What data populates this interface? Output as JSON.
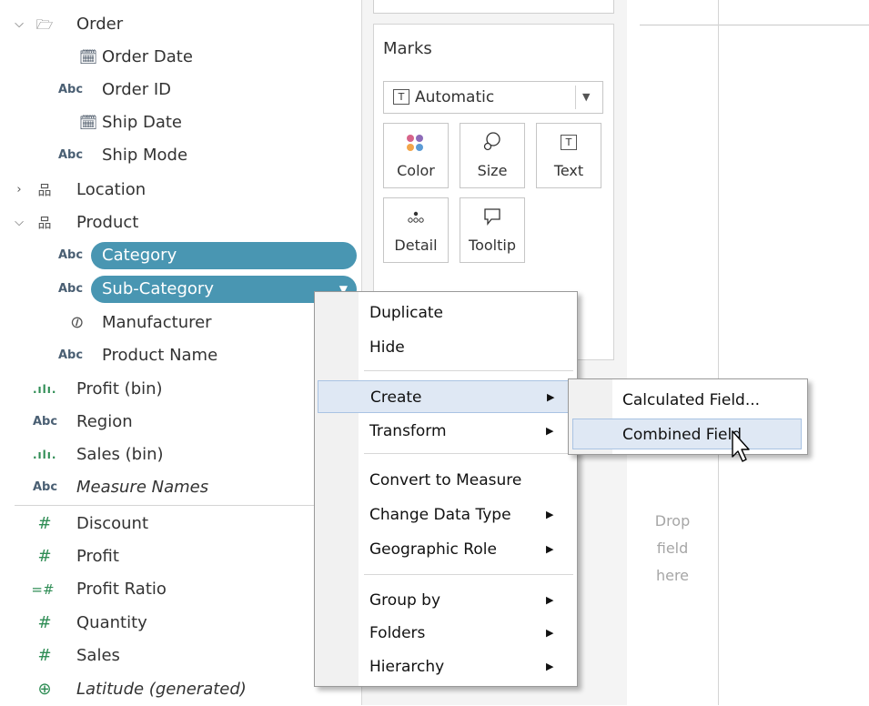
{
  "data_pane": {
    "folder_order": {
      "label": "Order",
      "chevron": "chevron-down-icon",
      "icon": "folder-open-icon"
    },
    "order_fields": [
      {
        "icon": "calendar-icon",
        "glyph": "📅",
        "label": "Order Date"
      },
      {
        "icon": "abc-icon",
        "glyph": "Abc",
        "label": "Order ID"
      },
      {
        "icon": "calendar-icon",
        "glyph": "📅",
        "label": "Ship Date"
      },
      {
        "icon": "abc-icon",
        "glyph": "Abc",
        "label": "Ship Mode"
      }
    ],
    "folder_location": {
      "label": "Location",
      "chevron": "chevron-right-icon",
      "icon": "hierarchy-icon"
    },
    "folder_product": {
      "label": "Product",
      "chevron": "chevron-down-icon",
      "icon": "hierarchy-icon"
    },
    "selected_fields": [
      {
        "glyph": "Abc",
        "label": "Category"
      },
      {
        "glyph": "Abc",
        "label": "Sub-Category"
      }
    ],
    "product_fields": [
      {
        "icon": "paperclip-icon",
        "glyph": "🖇",
        "label": "Manufacturer"
      },
      {
        "icon": "abc-icon",
        "glyph": "Abc",
        "label": "Product Name"
      }
    ],
    "dimensions": [
      {
        "icon": "bin-icon",
        "glyph": ".ılı.",
        "label": "Profit (bin)",
        "italic": false
      },
      {
        "icon": "abc-icon",
        "glyph": "Abc",
        "label": "Region",
        "italic": false
      },
      {
        "icon": "bin-icon",
        "glyph": ".ılı.",
        "label": "Sales (bin)",
        "italic": false
      },
      {
        "icon": "abc-icon",
        "glyph": "Abc",
        "label": "Measure Names",
        "italic": true
      }
    ],
    "measures": [
      {
        "icon": "hash-icon",
        "glyph": "#",
        "label": "Discount",
        "italic": false
      },
      {
        "icon": "hash-icon",
        "glyph": "#",
        "label": "Profit",
        "italic": false
      },
      {
        "icon": "calc-hash-icon",
        "glyph": "=#",
        "label": "Profit Ratio",
        "italic": false
      },
      {
        "icon": "hash-icon",
        "glyph": "#",
        "label": "Quantity",
        "italic": false
      },
      {
        "icon": "hash-icon",
        "glyph": "#",
        "label": "Sales",
        "italic": false
      },
      {
        "icon": "globe-icon",
        "glyph": "🌐",
        "label": "Latitude (generated)",
        "italic": true
      }
    ]
  },
  "marks_card": {
    "title": "Marks",
    "mark_type": {
      "value": "Automatic",
      "icon": "text-mark-icon"
    },
    "buttons": [
      {
        "name": "color",
        "label": "Color",
        "icon": "color-dots-icon"
      },
      {
        "name": "size",
        "label": "Size",
        "icon": "size-icon"
      },
      {
        "name": "text",
        "label": "Text",
        "icon": "text-mark-icon"
      },
      {
        "name": "detail",
        "label": "Detail",
        "icon": "detail-icon"
      },
      {
        "name": "tooltip",
        "label": "Tooltip",
        "icon": "speech-bubble-icon"
      }
    ],
    "color_dots": [
      "#d7648a",
      "#8d6bb8",
      "#f2a54a",
      "#5b9bd5"
    ]
  },
  "canvas": {
    "drop_hint_lines": [
      "Drop",
      "field",
      "here"
    ]
  },
  "context_menu": {
    "items": [
      {
        "label": "Duplicate",
        "submenu": false,
        "highlighted": false
      },
      {
        "label": "Hide",
        "submenu": false,
        "highlighted": false
      },
      {
        "label": "Create",
        "submenu": true,
        "highlighted": true
      },
      {
        "label": "Transform",
        "submenu": true,
        "highlighted": false
      },
      {
        "label": "Convert to Measure",
        "submenu": false,
        "highlighted": false
      },
      {
        "label": "Change Data Type",
        "submenu": true,
        "highlighted": false
      },
      {
        "label": "Geographic Role",
        "submenu": true,
        "highlighted": false
      },
      {
        "label": "Group by",
        "submenu": true,
        "highlighted": false
      },
      {
        "label": "Folders",
        "submenu": true,
        "highlighted": false
      },
      {
        "label": "Hierarchy",
        "submenu": true,
        "highlighted": false
      }
    ],
    "submenu_arrow": "▶"
  },
  "create_submenu": {
    "items": [
      {
        "label": "Calculated Field...",
        "highlighted": false
      },
      {
        "label": "Combined Field",
        "highlighted": true
      }
    ]
  },
  "colors": {
    "selection_pill": "#4996b2",
    "menu_highlight": "#dfe8f4",
    "measure_icon": "#2f8d55",
    "dimension_icon": "#4a5f73"
  }
}
